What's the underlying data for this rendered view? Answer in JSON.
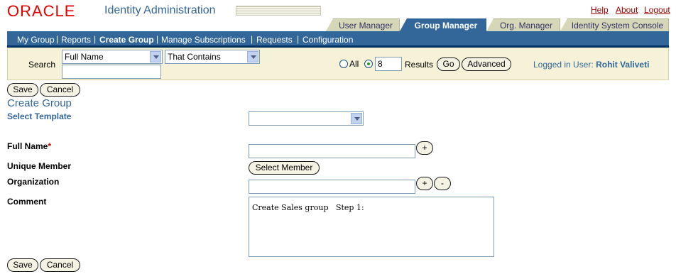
{
  "header": {
    "logo": "ORACLE",
    "app_title": "Identity Administration",
    "links": {
      "help": "Help",
      "about": "About",
      "logout": "Logout"
    }
  },
  "tabs": [
    {
      "label": "User Manager",
      "active": false
    },
    {
      "label": "Group Manager",
      "active": true
    },
    {
      "label": "Org. Manager",
      "active": false
    },
    {
      "label": "Identity System Console",
      "active": false
    }
  ],
  "subnav": [
    {
      "label": "My Group",
      "active": false
    },
    {
      "label": "Reports",
      "active": false
    },
    {
      "label": "Create Group",
      "active": true
    },
    {
      "label": "Manage Subscriptions",
      "active": false
    },
    {
      "label": "Requests",
      "active": false
    },
    {
      "label": "Configuration",
      "active": false
    }
  ],
  "search": {
    "label": "Search",
    "attribute_selected": "Full Name",
    "condition_selected": "That Contains",
    "query_value": "",
    "radio_all_label": "All",
    "results_value": "8",
    "results_label": "Results",
    "go_label": "Go",
    "advanced_label": "Advanced",
    "logged_in_prefix": "Logged in User:",
    "logged_in_user": "Rohit Valiveti"
  },
  "actions": {
    "save_label": "Save",
    "cancel_label": "Cancel"
  },
  "form": {
    "title": "Create Group",
    "select_template_label": "Select Template",
    "template_value": "",
    "full_name_label": "Full Name",
    "required_marker": "*",
    "full_name_value": "",
    "unique_member_label": "Unique Member",
    "select_member_label": "Select Member",
    "organization_label": "Organization",
    "organization_value": "",
    "comment_label": "Comment",
    "comment_value": "Create Sales group   Step 1:",
    "plus_label": "+",
    "minus_label": "-"
  },
  "colors": {
    "brand_red": "#e40000",
    "primary_blue": "#336699",
    "tab_inactive": "#d6d6b8",
    "panel_bg": "#f5f2d8"
  }
}
